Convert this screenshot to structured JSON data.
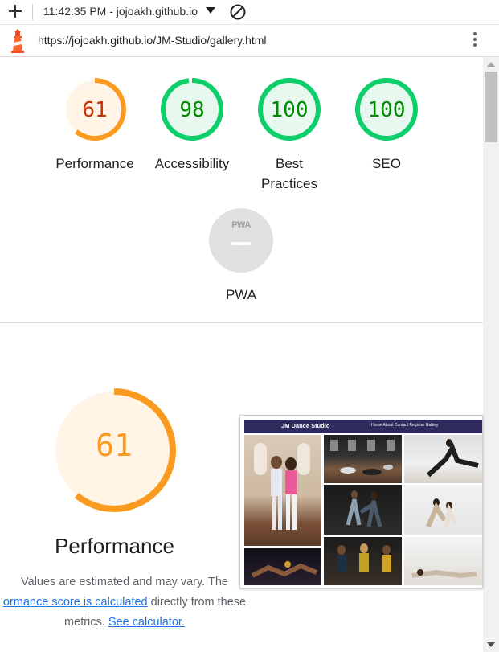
{
  "browser": {
    "tab_title": "11:42:35 PM - jojoakh.github.io",
    "url": "https://jojoakh.github.io/JM-Studio/gallery.html",
    "icons": [
      "plus-icon",
      "dropdown-caret-icon",
      "blocked-icon",
      "lighthouse-icon",
      "more-vert-icon"
    ]
  },
  "gauges": [
    {
      "score": "61",
      "label": "Performance",
      "value": 61,
      "color": "#fa9a1f",
      "text_color": "#c33300",
      "bg": "#fff4e6"
    },
    {
      "score": "98",
      "label": "Accessibility",
      "value": 98,
      "color": "#0cce6b",
      "text_color": "#008800",
      "bg": "#e7f9ee"
    },
    {
      "score": "100",
      "label": "Best Practices",
      "value": 100,
      "color": "#0cce6b",
      "text_color": "#008800",
      "bg": "#e7f9ee"
    },
    {
      "score": "100",
      "label": "SEO",
      "value": 100,
      "color": "#0cce6b",
      "text_color": "#008800",
      "bg": "#e7f9ee"
    }
  ],
  "pwa": {
    "badge": "PWA",
    "label": "PWA"
  },
  "performance": {
    "score": "61",
    "value": 61,
    "title": "Performance",
    "desc_line1": "Values are estimated and may vary. The",
    "desc_link1": "ormance score is calculated",
    "desc_mid": " directly from these",
    "desc_line3": "metrics. ",
    "desc_link2": "See calculator."
  },
  "thumbnail": {
    "brand": "JM Dance Studio",
    "nav_links": "Home  About  Contact  Register  Gallery"
  }
}
